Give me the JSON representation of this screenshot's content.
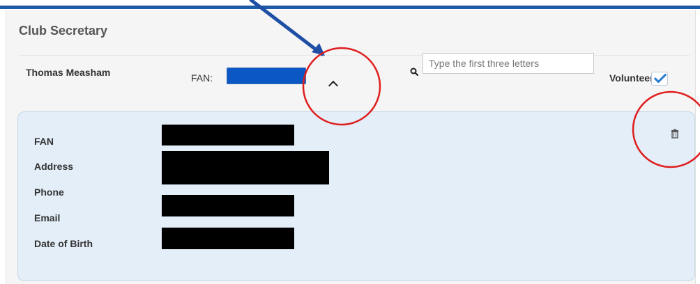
{
  "section": {
    "title": "Club Secretary"
  },
  "member": {
    "name": "Thomas Measham"
  },
  "fan": {
    "label": "FAN:"
  },
  "search": {
    "placeholder": "Type the first three letters",
    "value": ""
  },
  "volunteer": {
    "label": "Volunteer",
    "checked": true
  },
  "details": {
    "labels": [
      "FAN",
      "Address",
      "Phone",
      "Email",
      "Date of Birth"
    ]
  },
  "colors": {
    "accent": "#1f5aa6",
    "select_fill": "#0b57c4",
    "card_bg": "#e3eef8",
    "annotation_red": "#e01e1e",
    "annotation_blue": "#1f4fa5",
    "checkmark": "#2f7fd1"
  },
  "icons": [
    "search-icon",
    "chevron-up-icon",
    "checkmark-icon",
    "trash-icon"
  ]
}
